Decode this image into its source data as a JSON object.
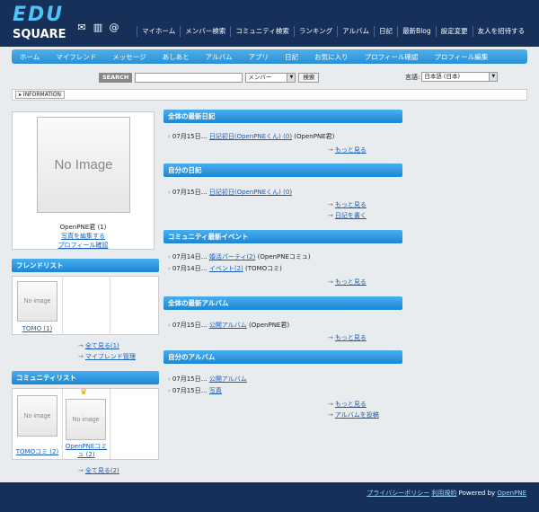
{
  "logo": {
    "line1": "EDU",
    "line2": "SQUARE"
  },
  "header_icons": [
    "mail-icon",
    "building-icon",
    "at-icon"
  ],
  "top_nav": [
    "マイホーム",
    "メンバー検索",
    "コミュニティ検索",
    "ランキング",
    "アルバム",
    "日記",
    "最新Blog",
    "設定変更",
    "友人を招待する"
  ],
  "sub_nav": [
    "ホーム",
    "マイフレンド",
    "メッセージ",
    "あしあと",
    "アルバム",
    "アプリ",
    "日記",
    "お気に入り",
    "プロフィール確認",
    "プロフィール編集"
  ],
  "search": {
    "label": "SEARCH",
    "value": "",
    "scope": "メンバー",
    "button": "検索"
  },
  "language": {
    "label": "言語:",
    "value": "日本語 (日本)"
  },
  "info": {
    "tag": "INFORMATION"
  },
  "profile": {
    "image_text": "No Image",
    "name": "OpenPNE君 (1)",
    "edit_photo": "写真を編集する",
    "view_profile": "プロフィール確認"
  },
  "friends": {
    "title": "フレンドリスト",
    "items": [
      {
        "image_text": "No image",
        "name": "TOMO (1)"
      }
    ],
    "see_all": "全て見る(1)",
    "manage": "マイフレンド管理"
  },
  "communities": {
    "title": "コミュニティリスト",
    "items": [
      {
        "image_text": "No image",
        "name": "TOMOコミ (2)"
      },
      {
        "image_text": "No image",
        "name": "OpenPNEコミュ (2)"
      }
    ],
    "see_all": "全て見る(2)"
  },
  "sections": [
    {
      "title": "全体の最新日記",
      "entries": [
        {
          "date": "07月15日…",
          "link": "日記初日(OpenPNEくん) (0)",
          "suffix": "(OpenPNE君)"
        }
      ],
      "links": [
        "もっと見る"
      ]
    },
    {
      "title": "自分の日記",
      "entries": [
        {
          "date": "07月15日…",
          "link": "日記初日(OpenPNEくん) (0)",
          "suffix": ""
        }
      ],
      "links": [
        "もっと見る",
        "日記を書く"
      ]
    },
    {
      "title": "コミュニティ最新イベント",
      "entries": [
        {
          "date": "07月14日…",
          "link": "婚活パーティ(2)",
          "suffix": "(OpenPNEコミュ)"
        },
        {
          "date": "07月14日…",
          "link": "イベント(2)",
          "suffix": "(TOMOコミ)"
        }
      ],
      "links": [
        "もっと見る"
      ]
    },
    {
      "title": "全体の最新アルバム",
      "entries": [
        {
          "date": "07月15日…",
          "link": "公開アルバム",
          "suffix": "(OpenPNE君)"
        }
      ],
      "links": [
        "もっと見る"
      ]
    },
    {
      "title": "自分のアルバム",
      "entries": [
        {
          "date": "07月15日…",
          "link": "公開アルバム",
          "suffix": ""
        },
        {
          "date": "07月15日…",
          "link": "写真",
          "suffix": ""
        }
      ],
      "links": [
        "もっと見る",
        "アルバムを投稿"
      ]
    }
  ],
  "footer": {
    "privacy": "プライバシーポリシー",
    "terms": "利用規約",
    "powered": "Powered by",
    "brand": "OpenPNE"
  },
  "colors": {
    "header_bg": "#17305a",
    "accent_blue": "#2a8fd6",
    "link": "#1a5fb4"
  }
}
